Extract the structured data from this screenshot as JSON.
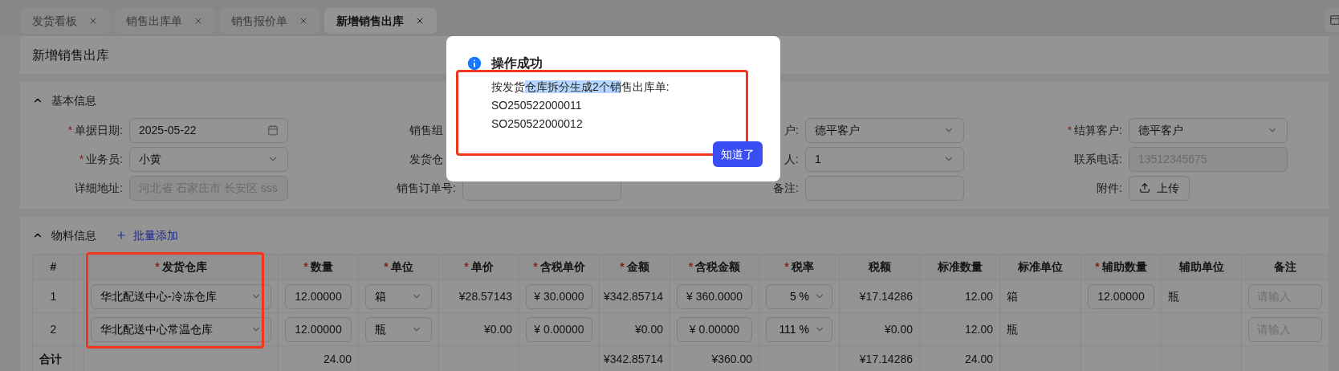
{
  "required_mark": "*",
  "tabs": [
    {
      "label": "发货看板",
      "selected": false
    },
    {
      "label": "销售出库单",
      "selected": false
    },
    {
      "label": "销售报价单",
      "selected": false
    },
    {
      "label": "新增销售出库",
      "selected": true
    }
  ],
  "page_title": "新增销售出库",
  "basic_info": {
    "title": "基本信息",
    "expanded": true,
    "fields": [
      {
        "label": "单据日期:",
        "required": true,
        "kind": "date",
        "value": "2025-05-22"
      },
      {
        "label": "销售组",
        "required": false,
        "clipped": true,
        "kind": "covered"
      },
      {
        "label": "户:",
        "required": false,
        "kind": "select",
        "value": "德平客户"
      },
      {
        "label": "结算客户:",
        "required": true,
        "kind": "select",
        "value": "德平客户"
      },
      {
        "label": "业务员:",
        "required": true,
        "kind": "select",
        "value": "小黄"
      },
      {
        "label": "发货仓",
        "required": false,
        "clipped": true,
        "kind": "covered"
      },
      {
        "label": "人:",
        "required": false,
        "kind": "select",
        "value": "1"
      },
      {
        "label": "联系电话:",
        "required": false,
        "kind": "disabled",
        "value": "13512345675"
      },
      {
        "label": "详细地址:",
        "required": false,
        "kind": "disabled",
        "value": "河北省 石家庄市 长安区 sss"
      },
      {
        "label": "销售订单号:",
        "required": false,
        "kind": "input"
      },
      {
        "label": "备注:",
        "required": false,
        "kind": "input"
      },
      {
        "label": "附件:",
        "required": false,
        "kind": "upload",
        "value": "上传"
      }
    ]
  },
  "materials": {
    "title": "物料信息",
    "expanded": true,
    "add_button": "批量添加",
    "table": {
      "columns": [
        {
          "label": "#",
          "required": false
        },
        {
          "label": "发货仓库",
          "required": true
        },
        {
          "label": "数量",
          "required": true
        },
        {
          "label": "单位",
          "required": true
        },
        {
          "label": "单价",
          "required": true
        },
        {
          "label": "含税单价",
          "required": true
        },
        {
          "label": "金额",
          "required": true
        },
        {
          "label": "含税金额",
          "required": true
        },
        {
          "label": "税率",
          "required": true
        },
        {
          "label": "税额",
          "required": false
        },
        {
          "label": "标准数量",
          "required": false
        },
        {
          "label": "标准单位",
          "required": false
        },
        {
          "label": "辅助数量",
          "required": true
        },
        {
          "label": "辅助单位",
          "required": false
        },
        {
          "label": "备注",
          "required": false
        }
      ],
      "rows": [
        [
          {
            "kind": "text",
            "value": "1"
          },
          {
            "kind": "select",
            "value": "华北配送中心-冷冻仓库"
          },
          {
            "kind": "input",
            "value": "12.00000"
          },
          {
            "kind": "select",
            "value": "箱"
          },
          {
            "kind": "text",
            "value": "¥28.57143"
          },
          {
            "kind": "input",
            "value": "¥ 30.0000"
          },
          {
            "kind": "text",
            "value": "¥342.85714"
          },
          {
            "kind": "input",
            "value": "¥ 360.0000"
          },
          {
            "kind": "rate",
            "value": "5 %"
          },
          {
            "kind": "text",
            "value": "¥17.14286"
          },
          {
            "kind": "text",
            "value": "12.00"
          },
          {
            "kind": "text",
            "value": "箱"
          },
          {
            "kind": "input",
            "value": "12.00000"
          },
          {
            "kind": "text",
            "value": "瓶"
          },
          {
            "kind": "input",
            "placeholder": "请输入"
          }
        ],
        [
          {
            "kind": "text",
            "value": "2"
          },
          {
            "kind": "select",
            "value": "华北配送中心常温仓库"
          },
          {
            "kind": "input",
            "value": "12.00000"
          },
          {
            "kind": "select",
            "value": "瓶"
          },
          {
            "kind": "text",
            "value": "¥0.00"
          },
          {
            "kind": "input",
            "value": "¥ 0.00000"
          },
          {
            "kind": "text",
            "value": "¥0.00"
          },
          {
            "kind": "input",
            "value": "¥ 0.00000"
          },
          {
            "kind": "rate",
            "value": "111 %"
          },
          {
            "kind": "text",
            "value": "¥0.00"
          },
          {
            "kind": "text",
            "value": "12.00"
          },
          {
            "kind": "text",
            "value": "瓶"
          },
          {
            "kind": "empty"
          },
          {
            "kind": "empty"
          },
          {
            "kind": "input",
            "placeholder": "请输入"
          }
        ]
      ],
      "totals": [
        {
          "kind": "text",
          "value": "合计"
        },
        {
          "kind": "empty"
        },
        {
          "kind": "text",
          "value": "24.00"
        },
        {
          "kind": "empty"
        },
        {
          "kind": "empty"
        },
        {
          "kind": "empty"
        },
        {
          "kind": "text",
          "value": "¥342.85714"
        },
        {
          "kind": "text",
          "value": "¥360.00"
        },
        {
          "kind": "empty"
        },
        {
          "kind": "text",
          "value": "¥17.14286"
        },
        {
          "kind": "text",
          "value": "24.00"
        },
        {
          "kind": "empty"
        },
        {
          "kind": "empty"
        },
        {
          "kind": "empty"
        },
        {
          "kind": "empty"
        }
      ]
    }
  },
  "dialog": {
    "title": "操作成功",
    "message": {
      "before": "按发货",
      "highlighted": "仓库拆分生成2个销",
      "after": "售出库单:"
    },
    "order_numbers": [
      "SO250522000011",
      "SO250522000012"
    ],
    "button": "知道了"
  }
}
